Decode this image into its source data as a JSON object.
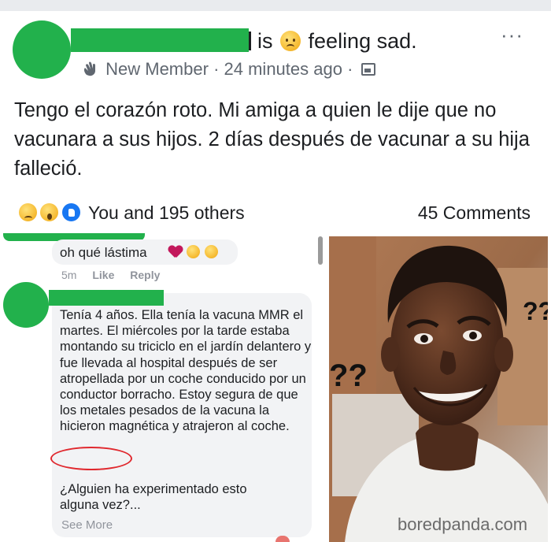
{
  "post": {
    "status_prefix": "is",
    "status_feeling": "feeling sad.",
    "member_badge": "New Member",
    "separator": "·",
    "time_ago": "24 minutes ago",
    "separator2": "·",
    "more_label": "···",
    "text": "Tengo el corazón roto. Mi amiga a quien le dije que no vacunara a sus hijos. 2 días después de vacunar a su hija falleció."
  },
  "reactions": {
    "summary": "You and 195 others",
    "comments": "45 Comments",
    "icons": [
      "sad-face-icon",
      "wow-face-icon",
      "like-icon"
    ]
  },
  "comments": {
    "first": {
      "text": "oh qué lástima",
      "time": "5m",
      "like_label": "Like",
      "reply_label": "Reply"
    },
    "second": {
      "text": "Tenía 4 años. Ella tenía la vacuna MMR el martes. El miércoles por la tarde estaba montando su triciclo en el jardín delantero y fue llevada al hospital después de ser atropellada por un coche conducido por un conductor borracho. Estoy segura de que los metales pesados de la vacuna la hicieron magnética y atrajeron al coche.",
      "question": "¿Alguien ha experimentado esto alguna vez?...",
      "see_more": "See More"
    }
  },
  "meme": {
    "left_marks": "??",
    "right_marks": "??",
    "watermark": "boredpanda.com"
  },
  "colors": {
    "censor_green": "#22b14c",
    "circle_red": "#e0282e",
    "muted_text": "#606770",
    "bubble_bg": "#f2f3f5"
  }
}
